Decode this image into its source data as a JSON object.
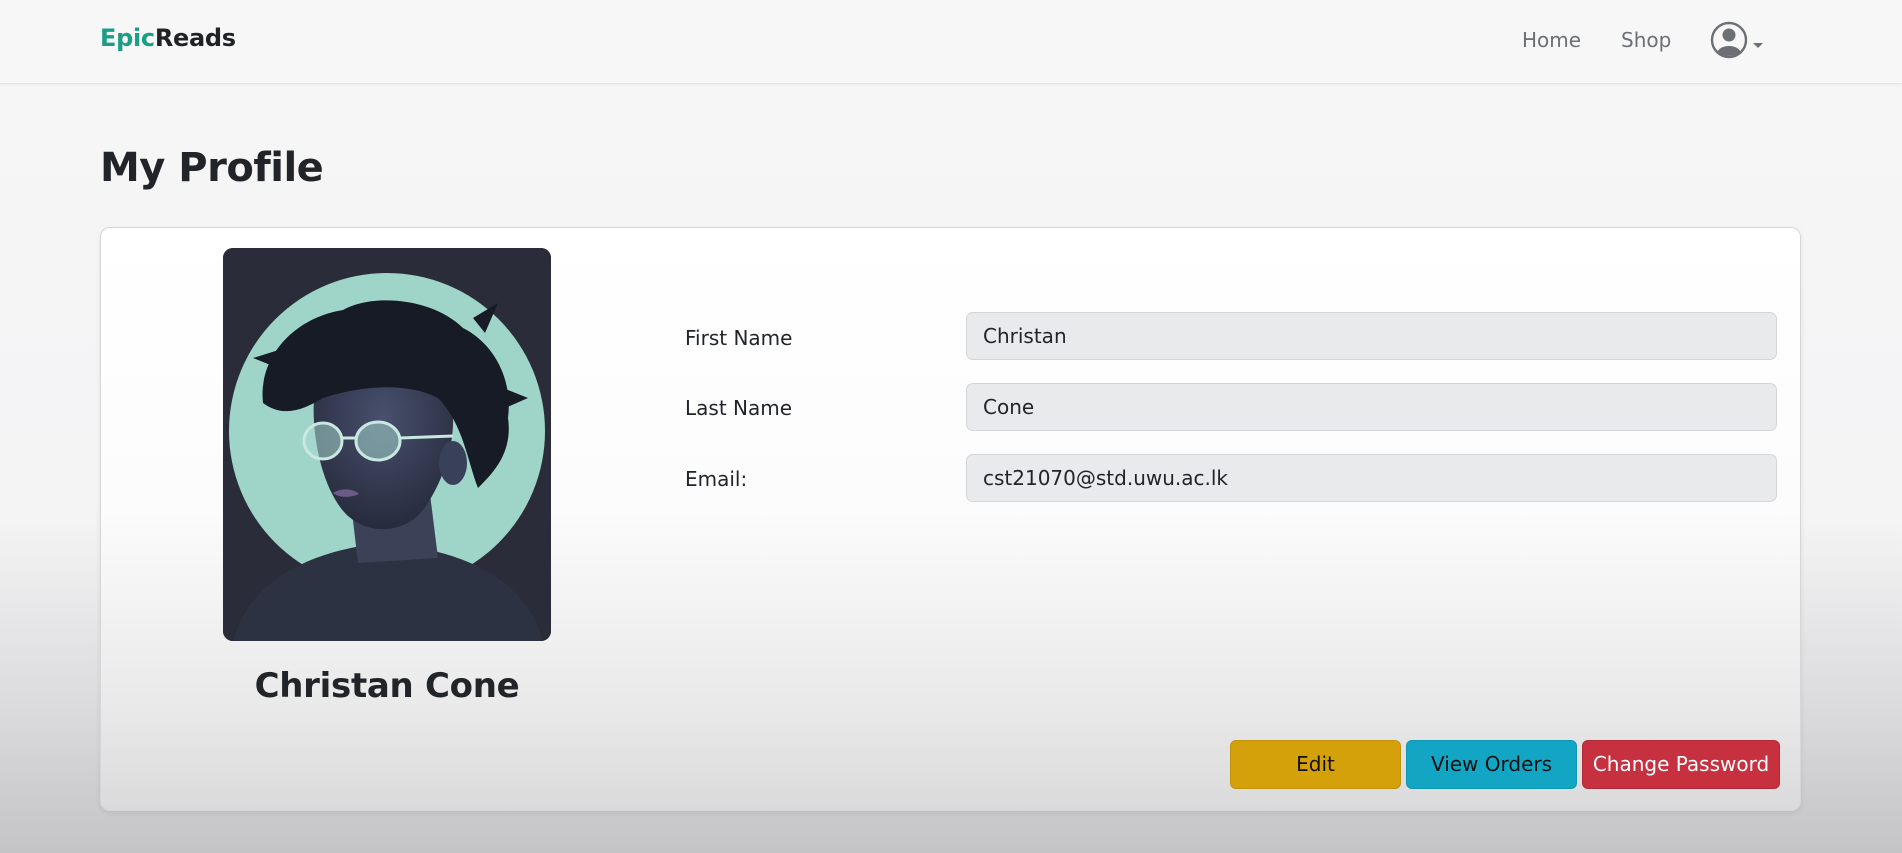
{
  "nav": {
    "brand_part1": "Epic",
    "brand_part2": "Reads",
    "links": [
      "Home",
      "Shop"
    ],
    "user_menu_icon": "user-circle-icon",
    "caret_icon": "caret-down-icon"
  },
  "page": {
    "title": "My Profile"
  },
  "profile": {
    "full_name": "Christan Cone",
    "avatar": "illustrated-portrait-with-glasses",
    "fields": [
      {
        "label": "First Name",
        "value": "Christan"
      },
      {
        "label": "Last Name",
        "value": "Cone"
      },
      {
        "label": "Email:",
        "value": "cst21070@std.uwu.ac.lk"
      }
    ]
  },
  "actions": {
    "edit": "Edit",
    "view_orders": "View Orders",
    "change_password": "Change Password"
  },
  "colors": {
    "brand_accent": "#1a9e86",
    "edit_button": "#d4a10b",
    "orders_button": "#12a6c4",
    "password_button": "#c6303f"
  }
}
